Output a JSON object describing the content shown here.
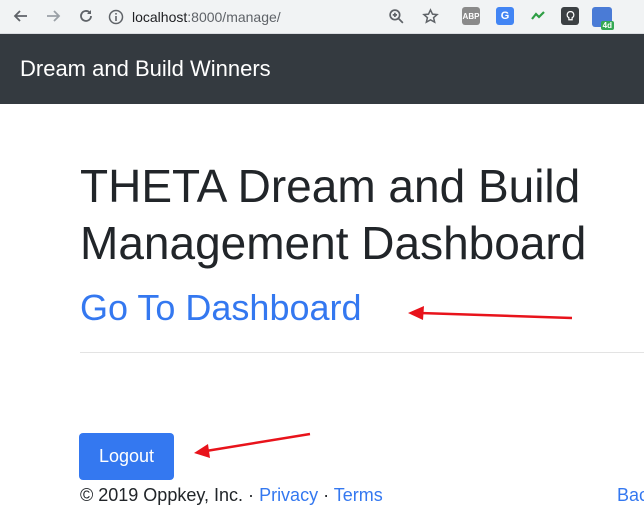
{
  "browser": {
    "url_host": "localhost",
    "url_rest": ":8000/manage/",
    "icons": [
      "back-icon",
      "forward-icon",
      "reload-icon",
      "info-icon",
      "zoom-icon",
      "star-icon"
    ],
    "extensions": [
      {
        "name": "abp-extension-icon",
        "label": "ABP",
        "color": "#8a8a8a"
      },
      {
        "name": "translate-extension-icon",
        "label": "G",
        "color": "#4285f4"
      },
      {
        "name": "grammar-extension-icon",
        "label": "",
        "color": "#2e9e44"
      },
      {
        "name": "lightbulb-extension-icon",
        "label": "",
        "color": "#3c4043"
      },
      {
        "name": "calendar-extension-icon",
        "label": "4d",
        "color": "#34a853"
      }
    ]
  },
  "navbar": {
    "brand": "Dream and Build Winners"
  },
  "main": {
    "title": "THETA Dream and Build Management Dashboard",
    "title_line1": "THETA Dream and Build",
    "title_line2": "Management Dashboard",
    "dashboard_link": "Go To Dashboard",
    "logout_label": "Logout"
  },
  "footer": {
    "copyright": "© 2019 Oppkey, Inc.",
    "separator": "·",
    "privacy": "Privacy",
    "terms": "Terms",
    "right_link": "Bac"
  },
  "colors": {
    "navbar_bg": "#343a40",
    "accent": "#3478f0",
    "annotation_arrow": "#e8131b"
  }
}
